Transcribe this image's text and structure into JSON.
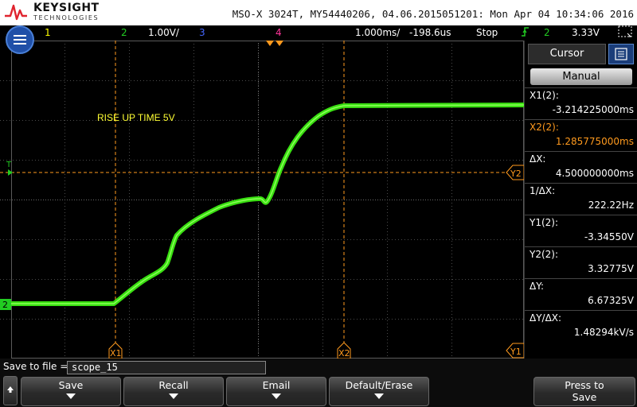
{
  "brand": {
    "name": "KEYSIGHT",
    "subtitle": "TECHNOLOGIES"
  },
  "header": {
    "title": "MSO-X 3024T, MY54440206, 04.06.2015051201: Mon Apr 04 10:34:06 2016"
  },
  "status": {
    "ch1": "1",
    "ch2": "2",
    "ch2_scale": "1.00V/",
    "ch3": "3",
    "ch4": "4",
    "timebase": "1.000ms/",
    "delay": "-198.6us",
    "run_state": "Stop",
    "trigger_channel": "2",
    "trigger_level": "3.33V"
  },
  "screen": {
    "annotation": "RISE UP TIME  5V",
    "trigger_marker": "T",
    "channel_marker": "2",
    "x1_label": "X1",
    "x2_label": "X2",
    "y1_label": "Y1",
    "y2_label": "Y2"
  },
  "cursor_panel": {
    "tab_label": "Cursor",
    "mode": "Manual",
    "items": [
      {
        "label": "X1(2):",
        "value": "-3.214225000ms",
        "color": "#ffffff"
      },
      {
        "label": "X2(2):",
        "value": "1.285775000ms",
        "color": "#ff9a1e"
      },
      {
        "label": "ΔX:",
        "value": "4.500000000ms",
        "color": "#ffffff"
      },
      {
        "label": "1/ΔX:",
        "value": "222.22Hz",
        "color": "#ffffff"
      },
      {
        "label": "Y1(2):",
        "value": "-3.34550V",
        "color": "#ffffff"
      },
      {
        "label": "Y2(2):",
        "value": "3.32775V",
        "color": "#ffffff"
      },
      {
        "label": "ΔY:",
        "value": "6.67325V",
        "color": "#ffffff"
      },
      {
        "label": "ΔY/ΔX:",
        "value": "1.48294kV/s",
        "color": "#ffffff"
      }
    ]
  },
  "savebar": {
    "label": "Save to file =",
    "filename": "scope_15",
    "keys": [
      "Save",
      "Recall",
      "Email",
      "Default/Erase"
    ],
    "press_label": "Press to",
    "press_action": "Save"
  },
  "colors": {
    "ch1": "#ffff00",
    "ch2": "#22cc22",
    "ch3": "#4466ff",
    "ch4": "#ff3399",
    "cursor": "#ff9a1e",
    "trace": "#39e011"
  }
}
